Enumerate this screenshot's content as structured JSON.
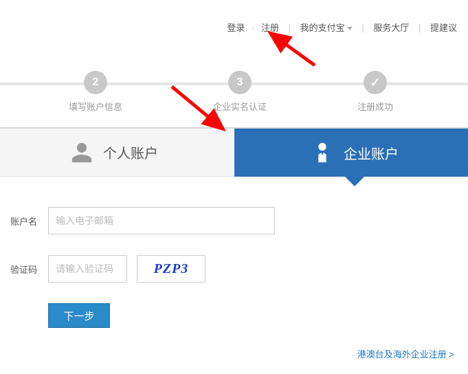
{
  "topnav": {
    "login": "登录",
    "register": "注册",
    "myAlipay": "我的支付宝",
    "serviceHall": "服务大厅",
    "feedback": "提建议"
  },
  "steps": {
    "s2": {
      "num": "2",
      "label": "填写账户信息"
    },
    "s3": {
      "num": "3",
      "label": "企业实名认证"
    },
    "s4": {
      "label": "注册成功"
    }
  },
  "tabs": {
    "personal": "个人账户",
    "corporate": "企业账户"
  },
  "form": {
    "accountLabel": "账户名",
    "accountPlaceholder": "输入电子邮箱",
    "captchaLabel": "验证码",
    "captchaPlaceholder": "请输入验证码",
    "captchaText": "PZP3",
    "nextBtn": "下一步"
  },
  "links": {
    "overseas": "港澳台及海外企业注册 >"
  }
}
